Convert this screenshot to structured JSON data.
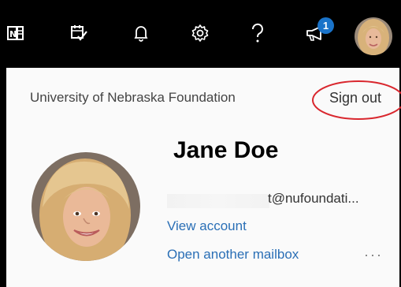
{
  "topbar": {
    "icons": [
      "onenote-icon",
      "tasks-icon",
      "bell-icon",
      "gear-icon",
      "help-icon",
      "megaphone-icon"
    ],
    "notification_count": "1"
  },
  "account_panel": {
    "organization": "University of Nebraska Foundation",
    "sign_out_label": "Sign out",
    "user_name": "Jane Doe",
    "email": "t@nufoundati...",
    "view_account_label": "View account",
    "open_mailbox_label": "Open another mailbox",
    "more_label": "···"
  },
  "colors": {
    "topbar_bg": "#000000",
    "link": "#2a6fb6",
    "badge": "#1a73c9",
    "highlight_circle": "#d9272e"
  }
}
